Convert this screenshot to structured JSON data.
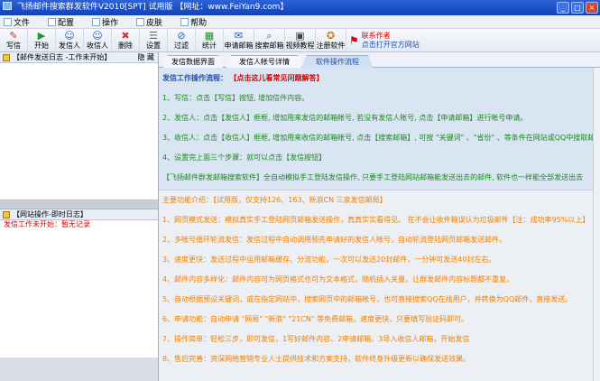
{
  "window": {
    "title": "飞扬邮件搜索群发软件V2010[SPT]  试用版 【网址：www.FeiYan9.com】"
  },
  "menu": [
    {
      "label": "文件"
    },
    {
      "label": "配置"
    },
    {
      "label": "操作"
    },
    {
      "label": "皮肤"
    },
    {
      "label": "帮助"
    }
  ],
  "toolbar": {
    "buttons": [
      {
        "label": "写信",
        "icon": "pencil-icon",
        "glyph": "✎",
        "color": "#d0342c"
      },
      {
        "label": "开始",
        "icon": "play-icon",
        "glyph": "▶",
        "color": "#1a9a2a"
      },
      {
        "label": "发信人",
        "icon": "user-icon",
        "glyph": "☺",
        "color": "#2060c0"
      },
      {
        "label": "收信人",
        "icon": "user-group-icon",
        "glyph": "☺",
        "color": "#2060c0"
      },
      {
        "label": "删除",
        "icon": "delete-icon",
        "glyph": "✖",
        "color": "#d0342c"
      },
      {
        "label": "设置",
        "icon": "settings-icon",
        "glyph": "☰",
        "color": "#666666"
      },
      {
        "label": "过滤",
        "icon": "filter-icon",
        "glyph": "⊘",
        "color": "#2060c0"
      },
      {
        "label": "统计",
        "icon": "stats-icon",
        "glyph": "▦",
        "color": "#2a8a2a"
      },
      {
        "label": "申请邮箱",
        "icon": "apply-mailbox-icon",
        "glyph": "✉",
        "color": "#2060c0"
      },
      {
        "label": "搜索邮箱",
        "icon": "search-icon",
        "glyph": "⌕",
        "color": "#2060c0"
      },
      {
        "label": "视频教程",
        "icon": "video-icon",
        "glyph": "▣",
        "color": "#444444"
      },
      {
        "label": "注册软件",
        "icon": "register-icon",
        "glyph": "✪",
        "color": "#c08000"
      }
    ],
    "contact_label": "联系作者",
    "website_link": "点击打开官方网站"
  },
  "left_panel": {
    "log_header": "【邮件发送日志 -工作未开始】",
    "hide_label": "隐 藏",
    "site_header": "【网站操作-即时日志】",
    "status_line": "发信工作未开始：暂无记录"
  },
  "tabs": [
    {
      "label": "发信数据界面"
    },
    {
      "label": "发信人帐号详情"
    },
    {
      "label": "软件操作流程"
    }
  ],
  "instructions": {
    "title": "发信工作操作流程：",
    "title_link": "【点击这儿看常见问题解答】",
    "steps": [
      "1、写信：点击【写信】按钮, 增加信件内容。",
      "2、发信人：点击【发信人】框框, 增加用来发信的邮箱帐号, 若没有发信人帐号, 点击【申请邮箱】进行帐号申请。",
      "3、收信人：点击【收信人】框框, 增加用来收信的邮箱帐号, 点击【搜索邮箱】, 可按 \"关键词\" 、\"省份\" 、等条件在网站或QQ中搜取邮箱帐号",
      "4、设置完上面三个步骤：就可以点击【发信按钮】",
      "【飞扬邮件群发邮箱搜索软件】全自动模拟手工登陆发信操作, 只要手工登陆网站邮箱能发送出去的邮件, 软件也一样能全部发送出去"
    ]
  },
  "features": {
    "heading": "主要功能介绍：【试用版，仅支持126、163、新浪CN 三家发信邮局】",
    "items": [
      "1、网页模式发送：模拟真实手工登陆网页邮箱发送操作，真真实实看得见。 在不会让收件箱误认为垃圾邮件【注：成功率95%以上】",
      "2、多帐号循环轮流发信：发信过程中自动调用预先申请好的发信人帐号，自动轮流登陆网页邮箱发送邮件。",
      "3、速度更快：发送过程中运用邮箱缓存、分流功能，一次可以发送20封邮件，一分钟可发送40封左右。",
      "4、邮件内容多样化：邮件内容可为网页格式也可为文本格式，随机插入关量，让群发邮件内容标题都不重复。",
      "5、自动根据预设关键词，或在指定网站中，搜索网页中的邮箱帐号，也可直接搜索QQ在线用户，并转换为QQ邮件，直接发送。",
      "6、申请功能：自动申请 \"网易\" \"新浪\" \"21CN\" 等免费邮箱，速度更快，只要填写验证码即可。",
      "7、操作简单：轻松三步，即可发信，1写好邮件内容、2申请邮箱、3导入收信人邮箱，开始发信",
      "8、售后完善：资深网络营销专业人士提供技术和方案支持，软件终身升级更新以确保发送效果。"
    ]
  }
}
